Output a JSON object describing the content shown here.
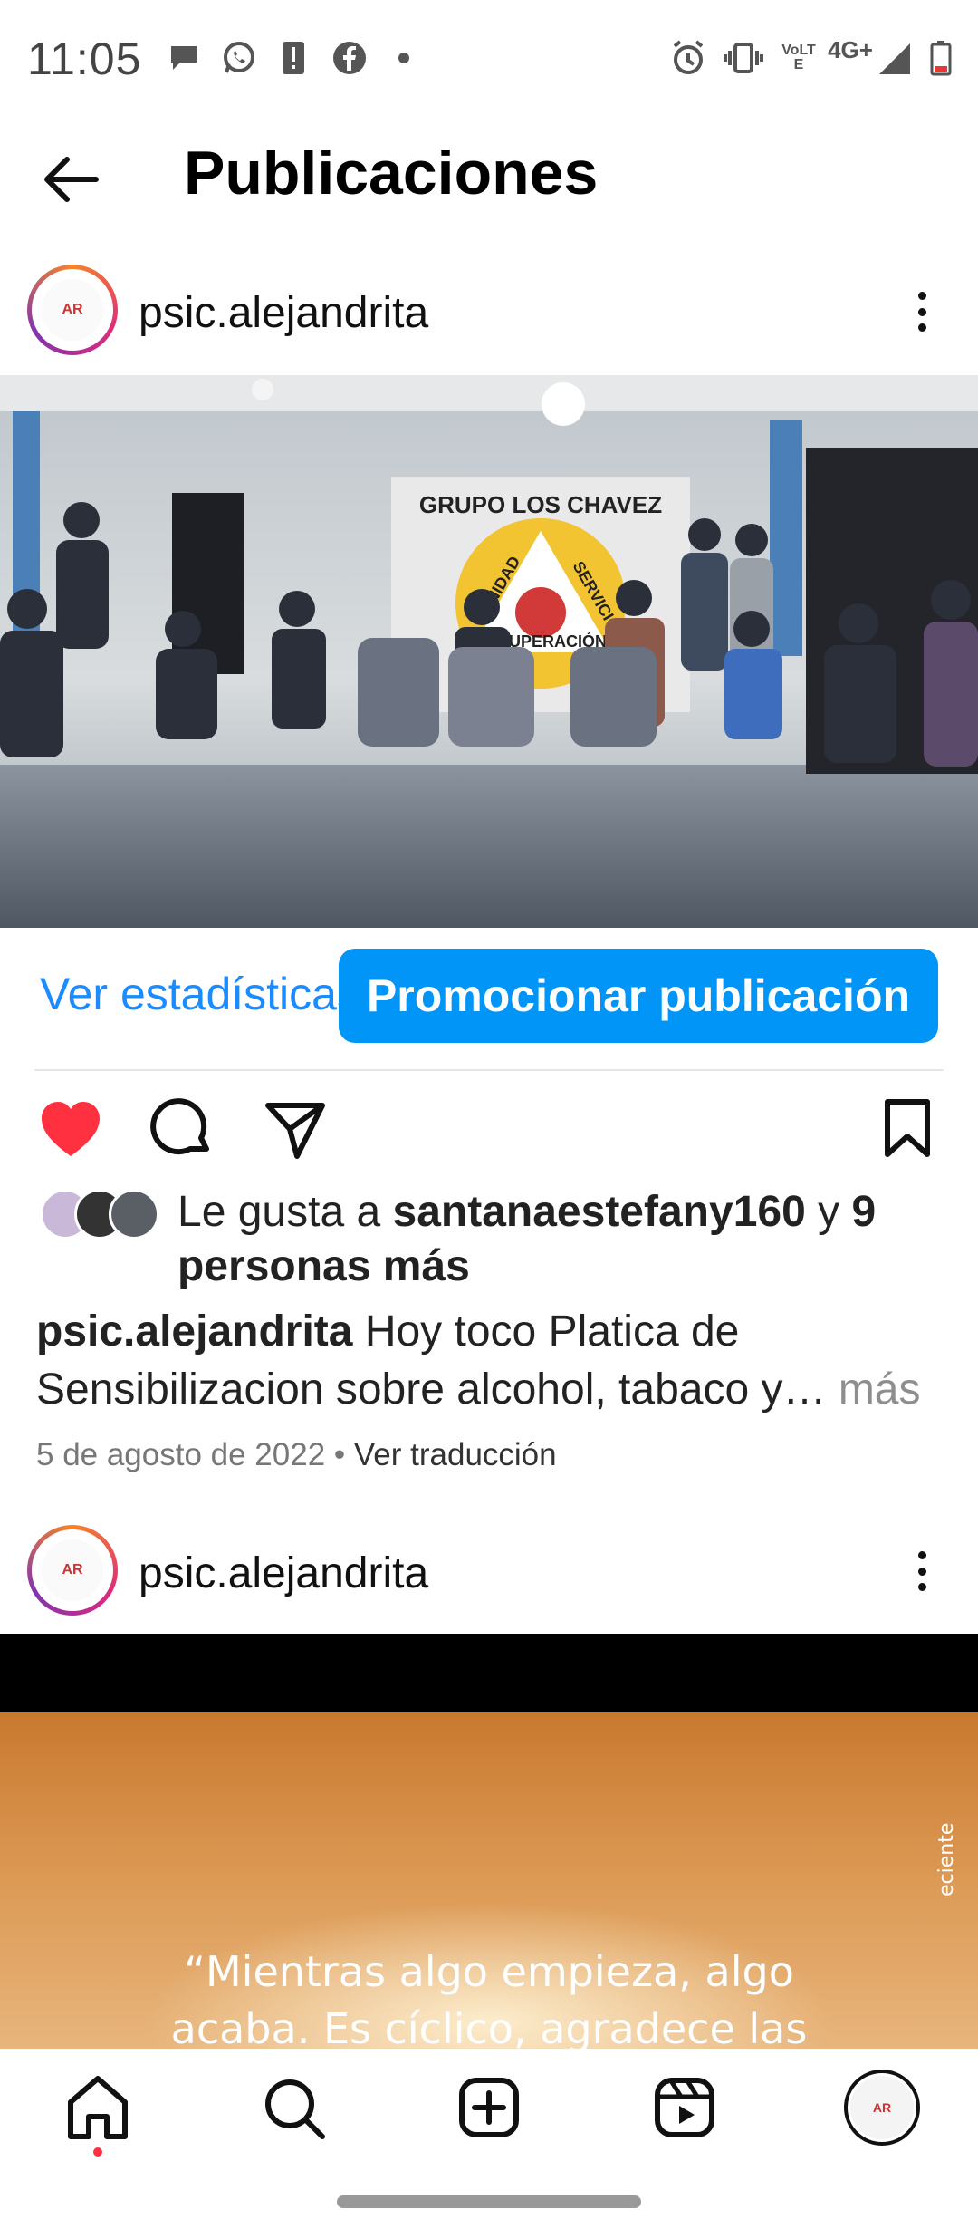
{
  "status_bar": {
    "time": "11:05",
    "icons": [
      "chat-bubble-icon",
      "whatsapp-icon",
      "alert-icon",
      "facebook-icon",
      "dot-icon",
      "alarm-icon",
      "vibrate-icon",
      "volte-icon",
      "signal-icon",
      "battery-icon"
    ],
    "network": "4G+",
    "volte": "VoLTE"
  },
  "header": {
    "title": "Publicaciones"
  },
  "post1": {
    "username": "psic.alejandrita",
    "banner_text": "GRUPO LOS CHAVEZ",
    "banner_words": [
      "UNIDAD",
      "SERVICIO",
      "RECUPERACIÓN"
    ],
    "stats_label": "Ver estadísticas",
    "promote_label": "Promocionar publicación",
    "likes": {
      "prefix": "Le gusta a ",
      "user": "santanaestefany160",
      "middle": " y ",
      "others": "9 personas más"
    },
    "caption": {
      "username": "psic.alejandrita",
      "text": " Hoy toco Platica de Sensibilizacion sobre alcohol, tabaco y…",
      "more": " más"
    },
    "date": "5 de agosto de 2022",
    "separator": " • ",
    "translate": "Ver traducción"
  },
  "post2": {
    "username": "psic.alejandrita",
    "quote_line1": "“Mientras algo empieza, algo",
    "quote_line2": "acaba. Es cíclico, agradece las",
    "side_text": "eciente"
  },
  "nav": {
    "items": [
      "home-icon",
      "search-icon",
      "create-icon",
      "reels-icon",
      "profile-avatar"
    ]
  },
  "colors": {
    "accent": "#0095f6",
    "link": "#1a8cff",
    "like": "#ff3040",
    "notification_dot": "#ff3040"
  }
}
